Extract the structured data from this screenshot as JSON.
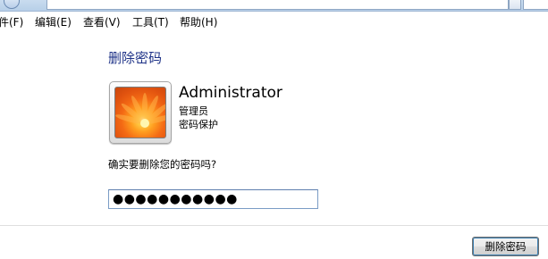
{
  "menubar": {
    "items": [
      {
        "label": "件(F)"
      },
      {
        "label": "编辑(E)"
      },
      {
        "label": "查看(V)"
      },
      {
        "label": "工具(T)"
      },
      {
        "label": "帮助(H)"
      }
    ]
  },
  "page": {
    "title": "删除密码",
    "user": {
      "name": "Administrator",
      "role": "管理员",
      "status": "密码保护"
    },
    "question": "确实要删除您的密码吗?",
    "password_value": "●●●●●●●●●●●",
    "delete_button_label": "删除密码"
  },
  "colors": {
    "title": "#1e3287",
    "input_border": "#7a9cc5"
  }
}
